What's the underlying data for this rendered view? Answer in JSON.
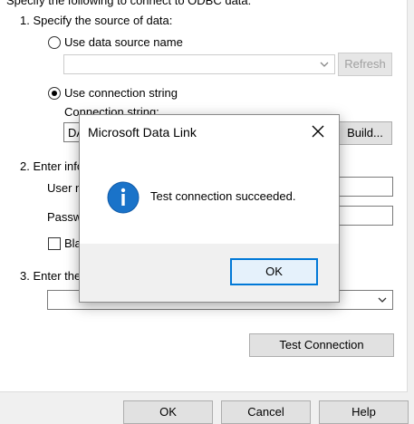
{
  "header": {
    "intro_text": "Specify the following to connect to ODBC data:"
  },
  "step1": {
    "label": "1. Specify the source of data:",
    "dsn_radio_label": "Use data source name",
    "dsn_value": "",
    "refresh_button": "Refresh",
    "conn_radio_label": "Use connection string",
    "conn_label": "Connection string:",
    "conn_value": "DA",
    "build_button": "Build..."
  },
  "step2": {
    "label": "2. Enter info",
    "user_label": "User n",
    "user_value": "",
    "password_label": "Passw",
    "password_value": "",
    "blank_label": "Bla"
  },
  "step3": {
    "label": "3. Enter the",
    "value": ""
  },
  "test_connection_button": "Test Connection",
  "footer": {
    "ok_button": "OK",
    "cancel_button": "Cancel",
    "help_button": "Help"
  },
  "dialog": {
    "title": "Microsoft Data Link",
    "message": "Test connection succeeded.",
    "ok_button": "OK",
    "close_icon": "close-icon",
    "info_icon": "info-icon",
    "accent_color": "#0078d7",
    "icon_color": "#1a73c9"
  }
}
